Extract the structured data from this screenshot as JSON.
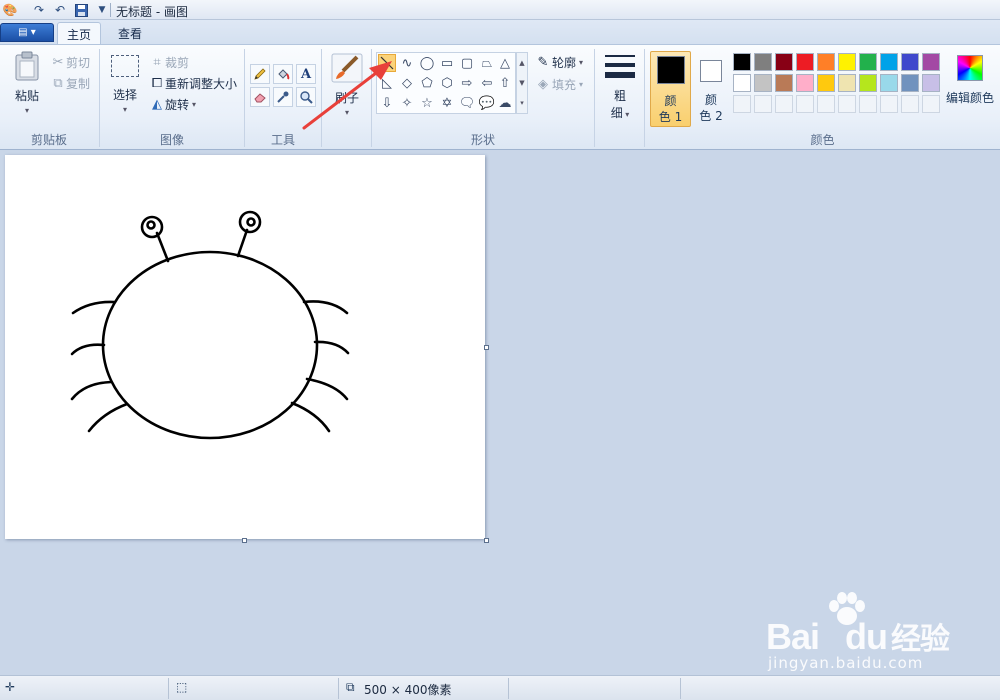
{
  "window": {
    "title": "无标题 - 画图"
  },
  "tabs": [
    {
      "label": "主页",
      "active": true
    },
    {
      "label": "查看",
      "active": false
    }
  ],
  "clipboard": {
    "paste": "粘贴",
    "cut": "剪切",
    "copy": "复制",
    "group_label": "剪贴板"
  },
  "image": {
    "select": "选择",
    "crop": "裁剪",
    "resize": "重新调整大小",
    "rotate": "旋转",
    "group_label": "图像"
  },
  "tools": {
    "group_label": "工具",
    "text_tool_glyph": "A"
  },
  "brushes": {
    "label": "刷子"
  },
  "shapes": {
    "outline": "轮廓",
    "fill": "填充",
    "group_label": "形状"
  },
  "size": {
    "label_line1": "粗",
    "label_line2": "细"
  },
  "colors": {
    "color1_line1": "颜",
    "color1_line2": "色 1",
    "color2_line1": "颜",
    "color2_line2": "色 2",
    "edit": "编辑颜色",
    "group_label": "颜色",
    "color1_value": "#000000",
    "color2_value": "#ffffff",
    "palette_row1": [
      "#000000",
      "#7f7f7f",
      "#880015",
      "#ed1c24",
      "#ff7f27",
      "#fff200",
      "#22b14c",
      "#00a2e8",
      "#3f48cc",
      "#a349a4"
    ],
    "palette_row2": [
      "#ffffff",
      "#c3c3c3",
      "#b97a57",
      "#ffaec9",
      "#ffc90e",
      "#efe4b0",
      "#b5e61d",
      "#99d9ea",
      "#7092be",
      "#c8bfe7"
    ]
  },
  "status": {
    "canvas_size": "500 × 400像素"
  },
  "watermark": {
    "brand_a": "Bai",
    "brand_b": "du",
    "brand_cn": "经验",
    "url": "jingyan.baidu.com"
  },
  "annotation": {
    "arrow_color": "#e8403a"
  }
}
